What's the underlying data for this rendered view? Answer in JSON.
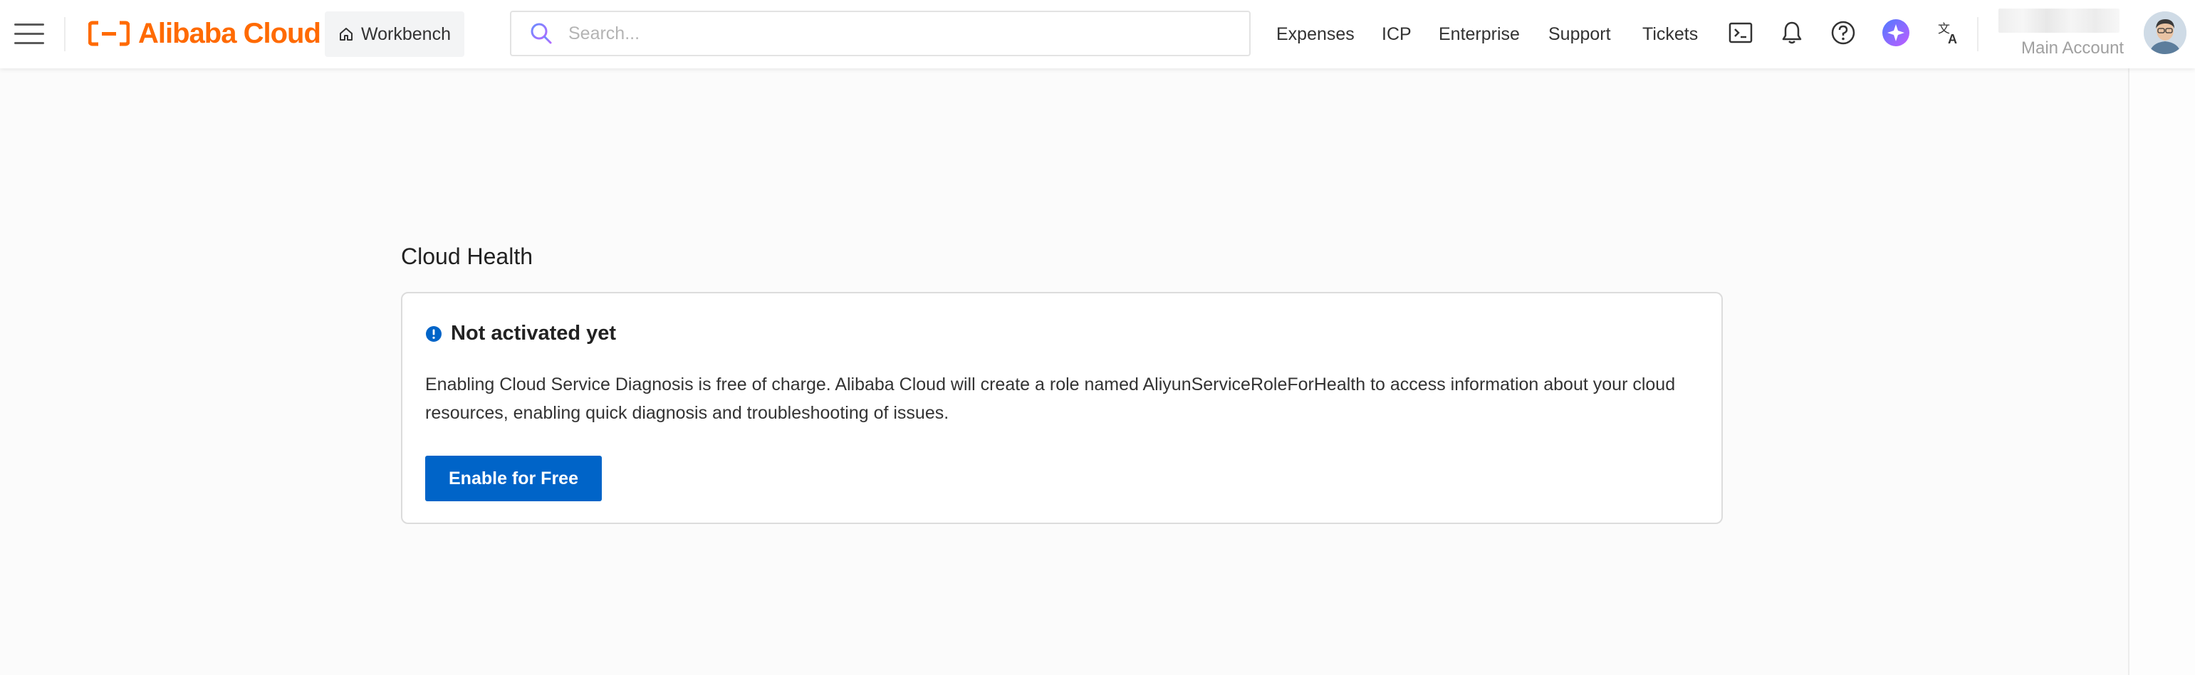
{
  "topbar": {
    "brand": "Alibaba Cloud",
    "workbench_label": "Workbench",
    "search_placeholder": "Search...",
    "nav": [
      "Expenses",
      "ICP",
      "Enterprise",
      "Support",
      "Tickets"
    ],
    "account_label": "Main Account",
    "icons": [
      "menu-icon",
      "home-icon",
      "search-icon",
      "terminal-icon",
      "bell-icon",
      "help-icon",
      "ai-assistant-icon",
      "language-icon"
    ]
  },
  "main": {
    "title": "Cloud Health",
    "card": {
      "heading": "Not activated yet",
      "description": "Enabling Cloud Service Diagnosis is free of charge. Alibaba Cloud will create a role named AliyunServiceRoleForHealth to access information about your cloud resources, enabling quick diagnosis and troubleshooting of issues.",
      "button_label": "Enable for Free"
    }
  },
  "colors": {
    "brand": "#ff6a00",
    "primary": "#0064c8",
    "info": "#0064c8"
  }
}
